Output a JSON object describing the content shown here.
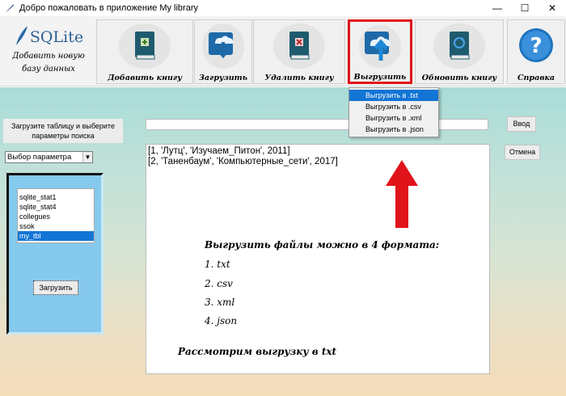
{
  "window": {
    "title": "Добро пожаловать в приложение My library",
    "controls": {
      "minimize": "—",
      "maximize": "☐",
      "close": "✕"
    }
  },
  "logo": {
    "brand": "SQLite",
    "subtitle_line1": "Добавить новую",
    "subtitle_line2": "базу данных"
  },
  "toolbar": {
    "buttons": [
      {
        "label": "Добавить книгу",
        "icon": "book-add-icon"
      },
      {
        "label": "Загрузить",
        "icon": "cloud-download-icon"
      },
      {
        "label": "Удалить книгу",
        "icon": "book-delete-icon"
      },
      {
        "label": "Выгрузить",
        "icon": "cloud-upload-icon",
        "active": true
      },
      {
        "label": "Обновить книгу",
        "icon": "book-refresh-icon"
      },
      {
        "label": "Справка",
        "icon": "help-icon"
      }
    ],
    "active_color": "#e0141b"
  },
  "export_menu": {
    "items": [
      "Выгрузить в .txt",
      "Выгрузить в .csv",
      "Выгрузить в .xml",
      "Выгрузить в .json"
    ],
    "highlighted_index": 0
  },
  "left": {
    "load_label": "Загрузите таблицу и выберите параметры поиска",
    "param_select": "Выбор параметра",
    "tables": [
      "sqlite_stat1",
      "sqlite_stat4",
      "collegues",
      "ssok",
      "my_tbl"
    ],
    "selected_table_index": 4,
    "load_button": "Загрузить"
  },
  "search": {
    "value": "",
    "enter_button": "Ввод",
    "cancel_button": "Отмена"
  },
  "output": {
    "lines": [
      "[1, 'Лутц', 'Изучаем_Питон', 2011]",
      "[2, 'Таненбаум', 'Компьютерные_сети', 2017]"
    ]
  },
  "note": {
    "heading": "Выгрузить файлы можно в 4 формата:",
    "formats": [
      "1. txt",
      "2. csv",
      "3. xml",
      "4. json"
    ],
    "footer": "Рассмотрим выгрузку в txt"
  },
  "colors": {
    "arrow": "#e0141b",
    "selection": "#1275d5",
    "accent_blue": "#2d5f95"
  }
}
